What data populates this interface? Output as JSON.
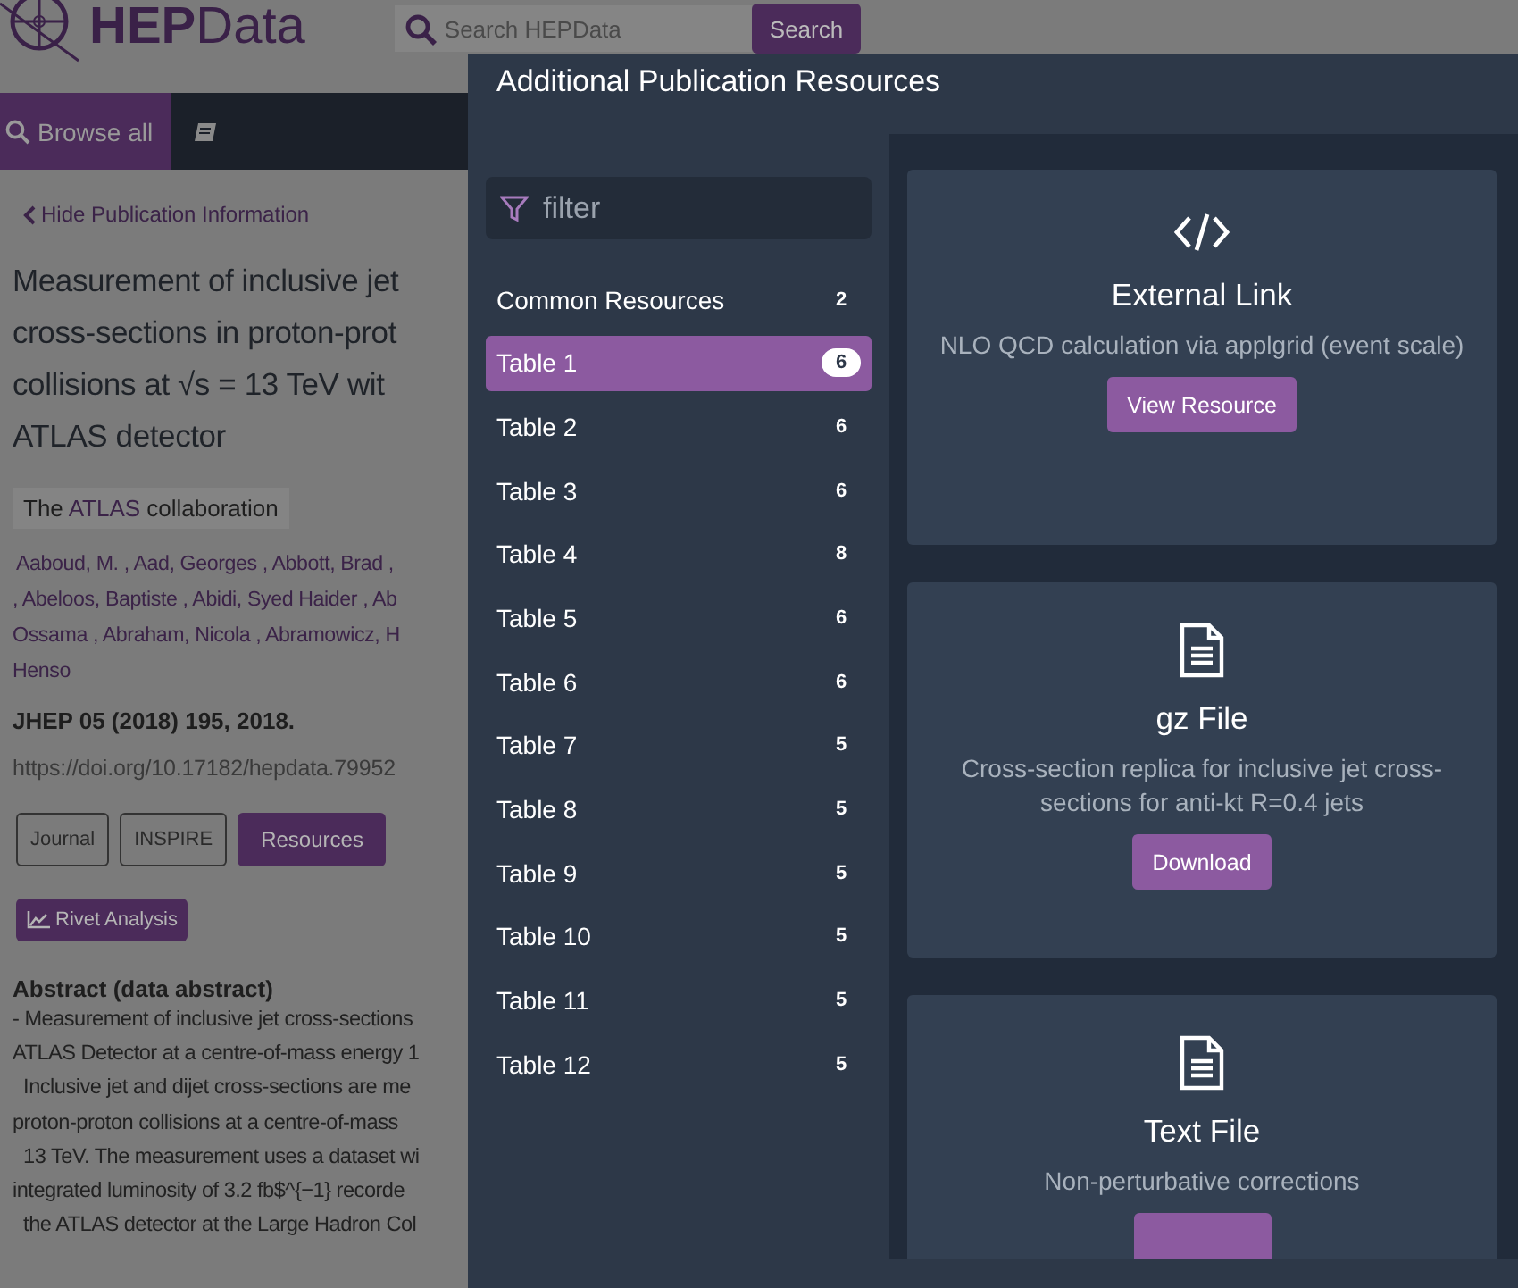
{
  "page": {
    "logo": "**HEP**Data",
    "search": {
      "placeholder": "Search HEPData",
      "button": "Search"
    },
    "nav": {
      "browse": "Browse all"
    },
    "back_link": "Hide Publication Information",
    "title_lines": [
      "Measurement of inclusive jet",
      "cross-sections in proton-prot",
      "collisions at √s = 13 TeV wit",
      "ATLAS detector"
    ],
    "collaboration": {
      "prefix": "The",
      "name": "ATLAS",
      "suffix": "collaboration"
    },
    "author_lines": [
      "Aaboud, M. , Aad, Georges , Abbott, Brad ,",
      ", Abeloos, Baptiste , Abidi, Syed Haider , Ab",
      "Ossama , Abraham, Nicola , Abramowicz, H",
      "Henso"
    ],
    "journal": "JHEP 05 (2018) 195, 2018.",
    "doi": "https://doi.org/10.17182/hepdata.79952",
    "buttons": [
      {
        "label": "Journal",
        "selected": false
      },
      {
        "label": "INSPIRE",
        "selected": false
      },
      {
        "label": "Resources",
        "selected": true
      }
    ],
    "rivet": "Rivet Analysis",
    "abstract_title": "Abstract (data abstract)",
    "abstract_lines": [
      "- Measurement of inclusive jet cross-sections",
      "ATLAS Detector at a centre-of-mass energy 1",
      "  Inclusive jet and dijet cross-sections are me",
      "proton-proton collisions at a centre-of-mass",
      "  13 TeV. The measurement uses a dataset wi",
      "integrated luminosity of 3.2 fb$^{−1} recorde",
      "  the ATLAS detector at the Large Hadron Col"
    ]
  },
  "modal": {
    "title": "Additional Publication Resources",
    "filter": {
      "placeholder": "filter"
    },
    "items": [
      {
        "label": "Common Resources",
        "count": "2",
        "selected": false
      },
      {
        "label": "Table 1",
        "count": "6",
        "selected": true
      },
      {
        "label": "Table 2",
        "count": "6",
        "selected": false
      },
      {
        "label": "Table 3",
        "count": "6",
        "selected": false
      },
      {
        "label": "Table 4",
        "count": "8",
        "selected": false
      },
      {
        "label": "Table 5",
        "count": "6",
        "selected": false
      },
      {
        "label": "Table 6",
        "count": "6",
        "selected": false
      },
      {
        "label": "Table 7",
        "count": "5",
        "selected": false
      },
      {
        "label": "Table 8",
        "count": "5",
        "selected": false
      },
      {
        "label": "Table 9",
        "count": "5",
        "selected": false
      },
      {
        "label": "Table 10",
        "count": "5",
        "selected": false
      },
      {
        "label": "Table 11",
        "count": "5",
        "selected": false
      },
      {
        "label": "Table 12",
        "count": "5",
        "selected": false
      }
    ],
    "resources": [
      {
        "kind": "link",
        "title": "External Link",
        "description": "NLO QCD calculation via applgrid (event scale)",
        "button": "View Resource"
      },
      {
        "kind": "file",
        "title": "gz File",
        "description": "Cross-section replica for inclusive jet cross-sections for anti-kt R=0.4 jets",
        "button": "Download"
      },
      {
        "kind": "file",
        "title": "Text File",
        "description": "Non-perturbative corrections"
      }
    ]
  }
}
